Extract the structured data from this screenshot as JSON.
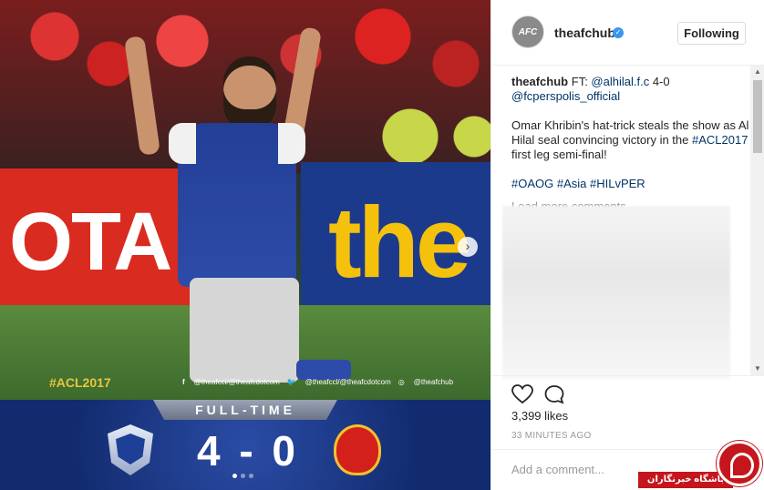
{
  "post": {
    "media": {
      "board_left_text": "OTA",
      "board_right_text": "the",
      "hashtag": "#ACL2017",
      "socials": [
        {
          "icon": "f",
          "text": "@theafccl/@theafcdotcom"
        },
        {
          "icon": "t",
          "text": "@theafccl/@theafcdotcom"
        },
        {
          "icon": "ig",
          "text": "@theafchub"
        }
      ],
      "banner": "FULL-TIME",
      "score": "4 - 0",
      "next_arrow": "›",
      "slides": 3,
      "current_slide": 1
    },
    "header": {
      "avatar_text": "AFC",
      "username": "theafchub",
      "verified_mark": "✓",
      "follow_label": "Following"
    },
    "caption": {
      "username": "theafchub",
      "line1_prefix": "FT: ",
      "mention1": "@alhilal.f.c",
      "line1_suffix": " 4-0",
      "mention2": "@fcperspolis_official",
      "body_part1": "Omar Khribin's hat-trick steals the show as Al Hilal seal convincing victory in the ",
      "body_hashtag": "#ACL2017",
      "body_part2": " first leg semi-final!",
      "hashtags": "#OAOG #Asia #HILvPER",
      "load_more": "Load more comments"
    },
    "stats": {
      "likes": "3,399 likes",
      "time": "33 MINUTES AGO"
    },
    "add_comment_placeholder": "Add a comment..."
  },
  "watermark": {
    "text": "باشگاه خبرنگاران"
  },
  "colors": {
    "link": "#003569",
    "verified": "#3897f0",
    "hashtag_gold": "#e8c63b",
    "watermark_red": "#c4161c"
  }
}
